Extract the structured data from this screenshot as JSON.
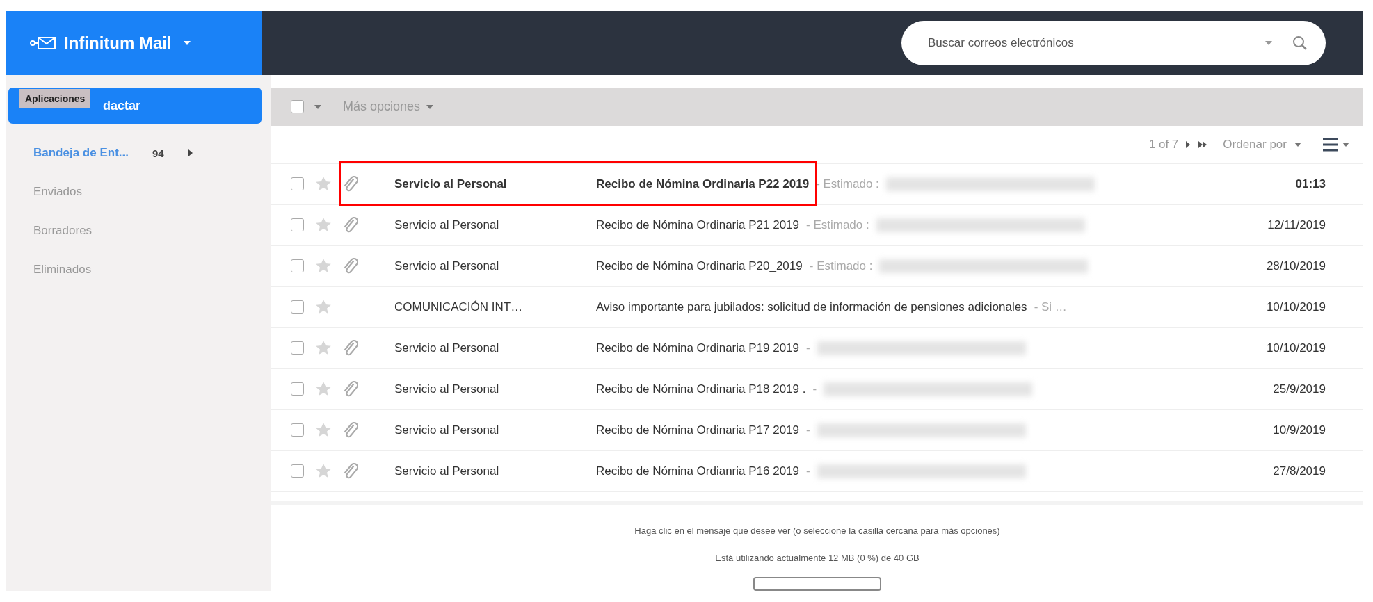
{
  "header": {
    "app_name": "Infinitum Mail",
    "search": {
      "placeholder": "Buscar correos electrónicos"
    }
  },
  "sidebar": {
    "compose_label": "dactar",
    "tooltip": "Aplicaciones",
    "folders": [
      {
        "label": "Bandeja de Ent...",
        "count": "94",
        "selected": true
      },
      {
        "label": "Enviados",
        "selected": false
      },
      {
        "label": "Borradores",
        "selected": false
      },
      {
        "label": "Eliminados",
        "selected": false
      }
    ]
  },
  "toolbar": {
    "select_all_checked": false,
    "more_options": "Más opciones"
  },
  "pager": {
    "range": "1 of 7",
    "sort": "Ordenar por"
  },
  "messages": [
    {
      "checked": false,
      "starred": false,
      "attachment": true,
      "unread": true,
      "highlighted": true,
      "sender": "Servicio al Personal",
      "subject": "Recibo de Nómina Ordinaria P22 2019",
      "preview": "- Estimado :",
      "blurred": true,
      "date": "01:13"
    },
    {
      "checked": false,
      "starred": false,
      "attachment": true,
      "unread": false,
      "highlighted": false,
      "sender": "Servicio al Personal",
      "subject": "Recibo de Nómina Ordinaria P21 2019",
      "preview": "- Estimado :",
      "blurred": true,
      "date": "12/11/2019"
    },
    {
      "checked": false,
      "starred": false,
      "attachment": true,
      "unread": false,
      "highlighted": false,
      "sender": "Servicio al Personal",
      "subject": "Recibo de Nómina Ordinaria P20_2019",
      "preview": "- Estimado :",
      "blurred": true,
      "date": "28/10/2019"
    },
    {
      "checked": false,
      "starred": false,
      "attachment": false,
      "unread": false,
      "highlighted": false,
      "sender": "COMUNICACIÓN INT…",
      "subject": "Aviso importante para jubilados: solicitud de información de pensiones adicionales",
      "preview": "- Si …",
      "blurred": false,
      "date": "10/10/2019"
    },
    {
      "checked": false,
      "starred": false,
      "attachment": true,
      "unread": false,
      "highlighted": false,
      "sender": "Servicio al Personal",
      "subject": "Recibo de Nómina Ordinaria P19 2019",
      "preview": "-",
      "blurred": true,
      "date": "10/10/2019"
    },
    {
      "checked": false,
      "starred": false,
      "attachment": true,
      "unread": false,
      "highlighted": false,
      "sender": "Servicio al Personal",
      "subject": "Recibo de Nómina Ordinaria P18 2019 .",
      "preview": "-",
      "blurred": true,
      "date": "25/9/2019"
    },
    {
      "checked": false,
      "starred": false,
      "attachment": true,
      "unread": false,
      "highlighted": false,
      "sender": "Servicio al Personal",
      "subject": "Recibo de Nómina Ordinaria P17 2019",
      "preview": "-",
      "blurred": true,
      "date": "10/9/2019"
    },
    {
      "checked": false,
      "starred": false,
      "attachment": true,
      "unread": false,
      "highlighted": false,
      "sender": "Servicio al Personal",
      "subject": "Recibo de Nómina Ordianria P16 2019",
      "preview": "-",
      "blurred": true,
      "date": "27/8/2019"
    }
  ],
  "footer": {
    "hint": "Haga clic en el mensaje que desee ver (o seleccione la casilla cercana para más opciones)",
    "usage": "Está utilizando actualmente 12 MB (0 %) de 40 GB"
  }
}
